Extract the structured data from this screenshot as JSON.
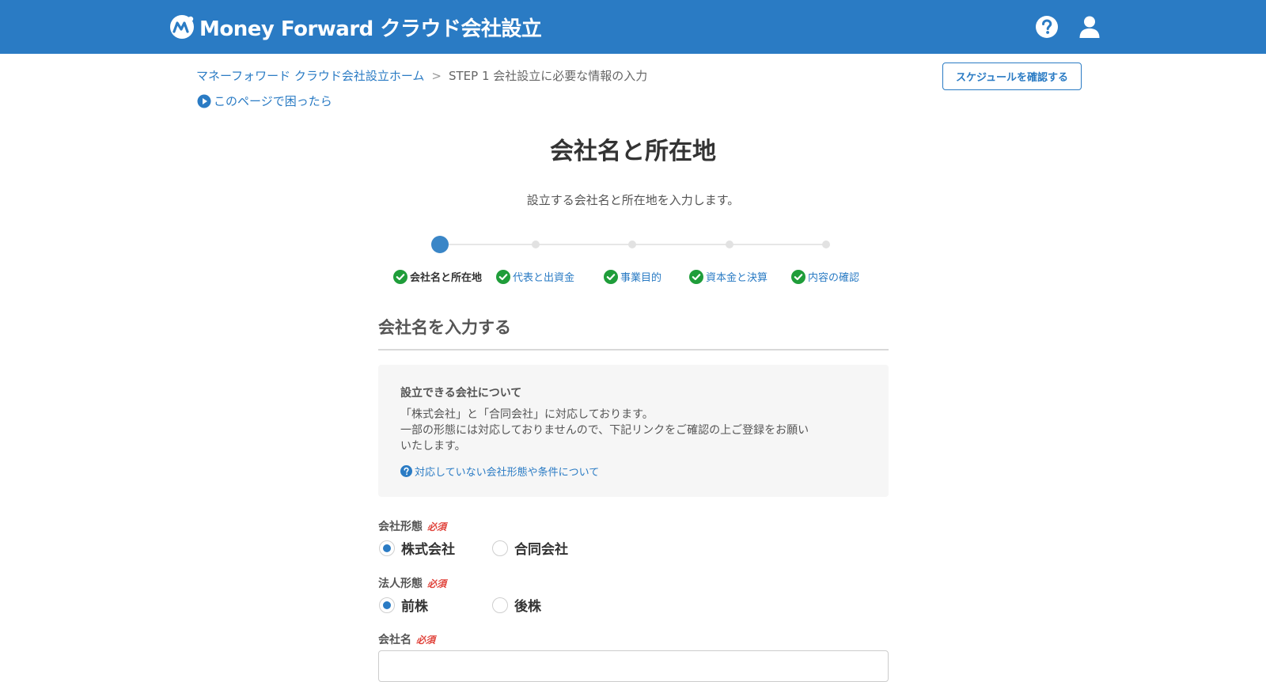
{
  "header": {
    "logo_text": "Money Forward クラウド会社設立",
    "brand_color": "#2a7bc4",
    "help_icon": "question-circle-icon",
    "user_icon": "user-icon"
  },
  "breadcrumb": {
    "home": "マネーフォワード クラウド会社設立ホーム",
    "separator": ">",
    "current": "STEP 1  会社設立に必要な情報の入力"
  },
  "help_link": "このページで困ったら",
  "schedule_button": "スケジュールを確認する",
  "page": {
    "title": "会社名と所在地",
    "subtitle": "設立する会社名と所在地を入力します。"
  },
  "stepper": {
    "current_index": 0,
    "steps": [
      {
        "label": "会社名と所在地"
      },
      {
        "label": "代表と出資金"
      },
      {
        "label": "事業目的"
      },
      {
        "label": "資本金と決算"
      },
      {
        "label": "内容の確認"
      }
    ]
  },
  "section": {
    "title": "会社名を入力する"
  },
  "info_box": {
    "title": "設立できる会社について",
    "lines": [
      "「株式会社」と「合同会社」に対応しております。",
      "一部の形態には対応しておりませんので、下記リンクをご確認の上ご登録をお願い",
      "いたします。"
    ],
    "link": "対応していない会社形態や条件について"
  },
  "form": {
    "required_label": "必須",
    "company_type": {
      "label": "会社形態",
      "options": [
        "株式会社",
        "合同会社"
      ],
      "selected": "株式会社"
    },
    "corp_position": {
      "label": "法人形態",
      "options": [
        "前株",
        "後株"
      ],
      "selected": "前株"
    },
    "company_name": {
      "label": "会社名",
      "value": ""
    }
  }
}
